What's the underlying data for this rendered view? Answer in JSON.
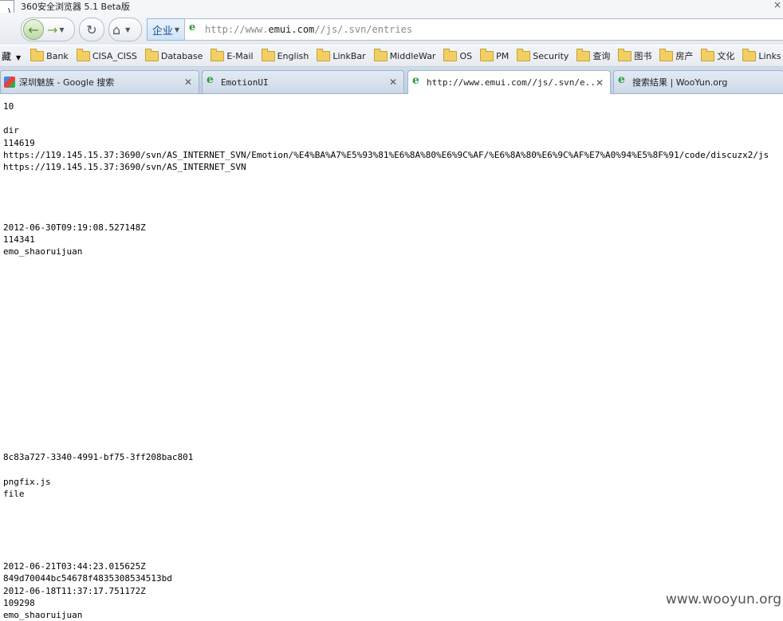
{
  "window": {
    "title": "360安全浏览器 5.1 Beta版",
    "close_glyph": "×",
    "logo_fragment": ")"
  },
  "nav": {
    "mode_label": "企业",
    "url_prefix": "http://www.",
    "url_host": "emui.com",
    "url_path": "//js/.svn/entries"
  },
  "bookmarks": {
    "lead": "藏",
    "items": [
      "Bank",
      "CISA_CISS",
      "Database",
      "E-Mail",
      "English",
      "LinkBar",
      "MiddleWar",
      "OS",
      "PM",
      "Security",
      "查询",
      "图书",
      "房产",
      "文化",
      "Links"
    ]
  },
  "tabs": [
    {
      "label": "深圳魅族 - Google 搜索",
      "icon": "google-icon",
      "active": false
    },
    {
      "label": "EmotionUI",
      "icon": "page-icon",
      "active": false
    },
    {
      "label": "http://www.emui.com//js/.svn/e...",
      "icon": "page-icon",
      "active": true
    },
    {
      "label": "搜索结果 | WooYun.org",
      "icon": "page-icon",
      "active": false
    }
  ],
  "content_lines": [
    "10",
    "",
    "dir",
    "114619",
    "https://119.145.15.37:3690/svn/AS_INTERNET_SVN/Emotion/%E4%BA%A7%E5%93%81%E6%8A%80%E6%9C%AF/%E6%8A%80%E6%9C%AF%E7%A0%94%E5%8F%91/code/discuzx2/js",
    "https://119.145.15.37:3690/svn/AS_INTERNET_SVN",
    "",
    "",
    "",
    "",
    "2012-06-30T09:19:08.527148Z",
    "114341",
    "emo_shaoruijuan",
    "",
    "",
    "",
    "",
    "",
    "",
    "",
    "",
    "",
    "",
    "",
    "",
    "",
    "",
    "",
    "",
    "8c83a727-3340-4991-bf75-3ff208bac801",
    "",
    "pngfix.js",
    "file",
    "",
    "",
    "",
    "",
    "",
    "2012-06-21T03:44:23.015625Z",
    "849d70044bc54678f4835308534513bd",
    "2012-06-18T11:37:17.751172Z",
    "109298",
    "emo_shaoruijuan"
  ],
  "watermark": "www.wooyun.org"
}
